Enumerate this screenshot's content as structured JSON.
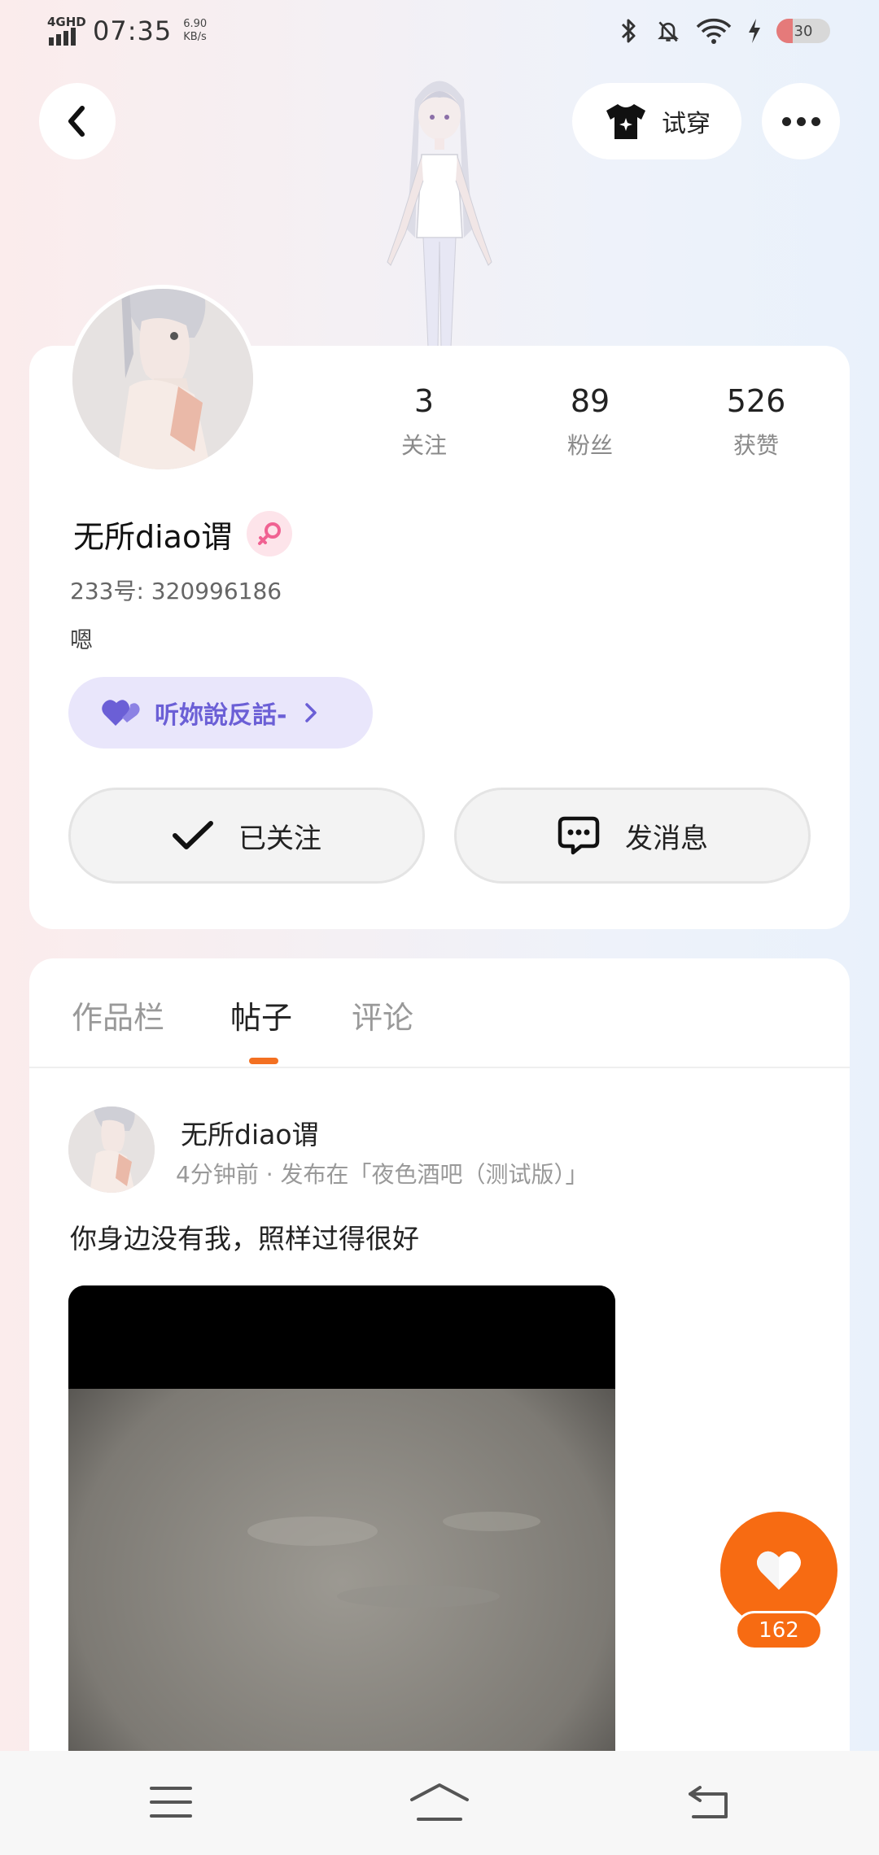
{
  "status_bar": {
    "network": "4GHD",
    "time": "07:35",
    "speed_value": "6.90",
    "speed_unit": "KB/s",
    "battery": "30",
    "battery_level": 0.3,
    "icons": [
      "bluetooth-icon",
      "bell-off-icon",
      "wifi-icon",
      "charging-icon",
      "battery-icon"
    ]
  },
  "header": {
    "back_icon": "chevron-left-icon",
    "tryon_label": "试穿",
    "tryon_icon": "tshirt-icon",
    "more_icon": "more-dots-icon"
  },
  "profile": {
    "stats": [
      {
        "value": "3",
        "label": "关注"
      },
      {
        "value": "89",
        "label": "粉丝"
      },
      {
        "value": "526",
        "label": "获赞"
      }
    ],
    "username": "无所diao谓",
    "gender_icon": "female-icon",
    "uid": "233号: 320996186",
    "bio": "嗯",
    "fan_badge": {
      "text": "听妳說反話-",
      "icon": "heart-icon"
    },
    "follow_button": "已关注",
    "message_button": "发消息"
  },
  "tabs": [
    "作品栏",
    "帖子",
    "评论"
  ],
  "active_tab": "帖子",
  "post": {
    "author": "无所diao谓",
    "meta": "4分钟前 · 发布在「夜色酒吧（测试版）」",
    "text": "你身边没有我，照样过得很好"
  },
  "like": {
    "count": "162"
  },
  "colors": {
    "accent": "#f76b12",
    "badge_purple": "#6b5fd6",
    "badge_bg": "#e9e6fb"
  }
}
